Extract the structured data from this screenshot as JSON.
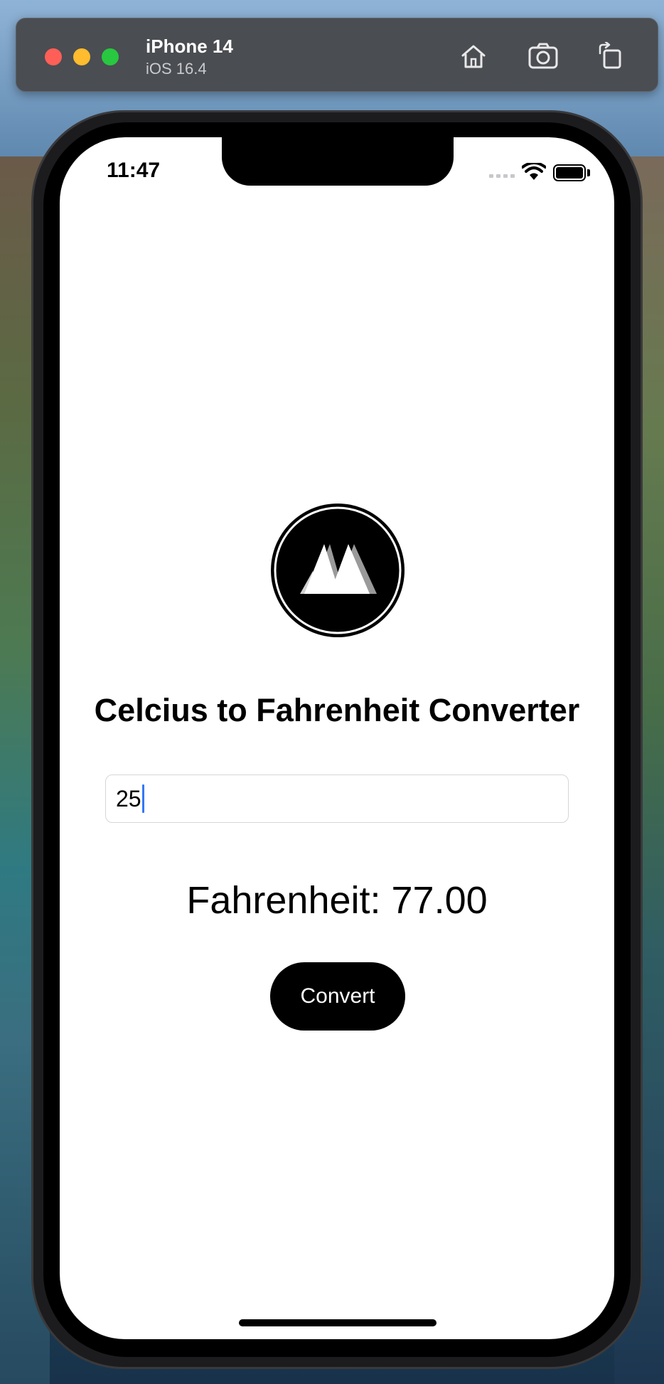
{
  "simulator": {
    "device_name": "iPhone 14",
    "os_version": "iOS 16.4",
    "toolbar": {
      "home_icon": "home-icon",
      "screenshot_icon": "camera-icon",
      "rotate_icon": "rotate-icon"
    }
  },
  "status_bar": {
    "time": "11:47"
  },
  "app": {
    "title": "Celcius to Fahrenheit Converter",
    "celsius_input_value": "25",
    "result_text": "Fahrenheit: 77.00",
    "convert_label": "Convert"
  },
  "colors": {
    "button_bg": "#000000",
    "cursor": "#3478f6"
  }
}
